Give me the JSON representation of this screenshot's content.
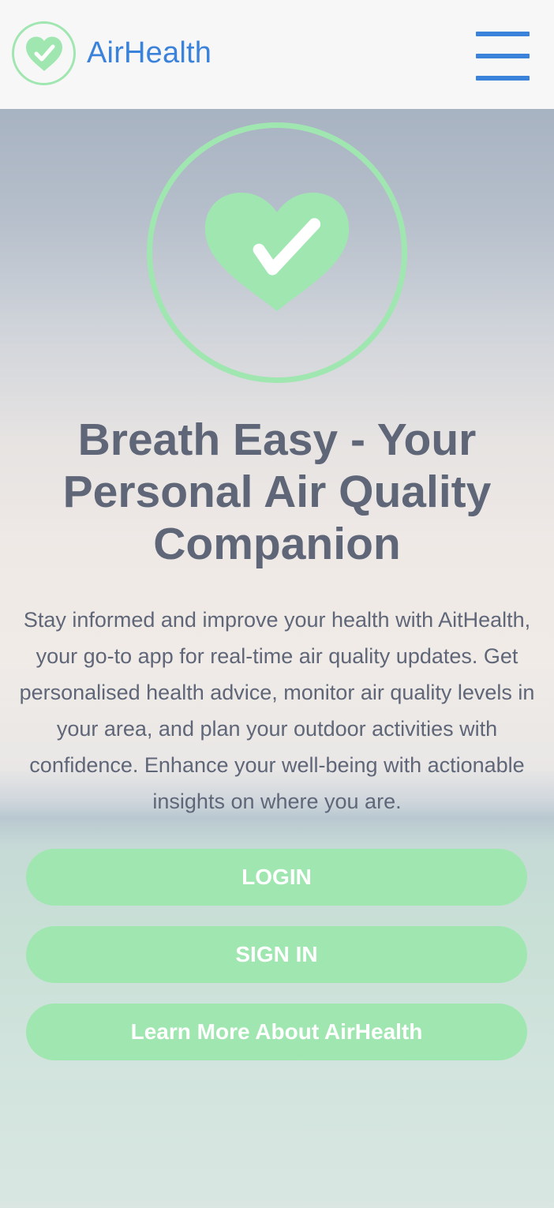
{
  "header": {
    "brand": "AirHealth",
    "logo_icon": "heart-check-icon",
    "menu_icon": "hamburger-menu-icon"
  },
  "hero": {
    "icon": "heart-check-icon",
    "title": "Breath Easy - Your Personal Air Quality Companion",
    "description": "Stay informed and improve your health with AitHealth, your go-to app for real-time air quality updates. Get personalised health advice, monitor air quality levels in your area, and plan your outdoor activities with confidence. Enhance your well-being with actionable insights on where you are."
  },
  "actions": {
    "login": "LOGIN",
    "sign_in": "SIGN IN",
    "learn_more": "Learn More About AirHealth"
  },
  "colors": {
    "accent_green": "#a0e6b0",
    "brand_blue": "#3b82db",
    "text_gray": "#5f6678"
  }
}
